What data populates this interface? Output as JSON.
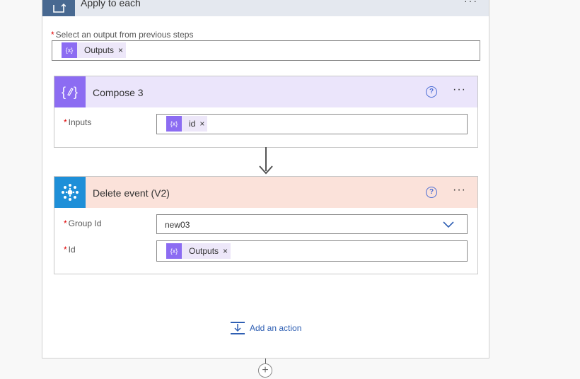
{
  "apply_to_each": {
    "title": "Apply to each",
    "more": "···",
    "select_label": "Select an output from previous steps",
    "required_mark": "*",
    "token": {
      "icon": "{x}",
      "label": "Outputs",
      "remove": "×"
    }
  },
  "compose": {
    "title": "Compose 3",
    "header_color": "#ebe5fb",
    "icon_color": "#8c6cf2",
    "help": "?",
    "more": "···",
    "inputs_label": "Inputs",
    "required_mark": "*",
    "token": {
      "icon": "{x}",
      "label": "id",
      "remove": "×"
    }
  },
  "delete_event": {
    "title": "Delete event (V2)",
    "header_color": "#fbe2da",
    "icon_color": "#1e8fd8",
    "help": "?",
    "more": "···",
    "group_id_label": "Group Id",
    "group_id_value": "new03",
    "id_label": "Id",
    "required_mark": "*",
    "token": {
      "icon": "{x}",
      "label": "Outputs",
      "remove": "×"
    }
  },
  "add_action": {
    "label": "Add an action"
  },
  "insert_step": {
    "label": "+"
  }
}
